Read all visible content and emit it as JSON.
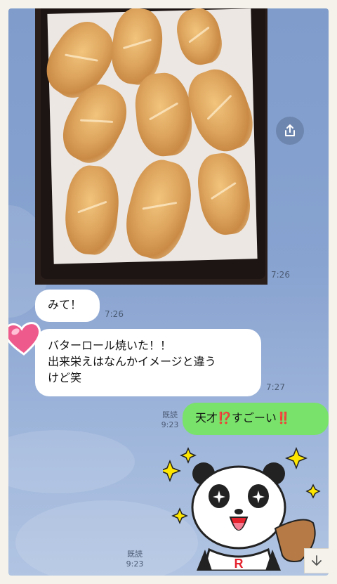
{
  "messages": {
    "photo": {
      "time": "7:26"
    },
    "msg1": {
      "text": "みて！",
      "time": "7:26"
    },
    "msg2": {
      "lines": [
        "バターロール焼いた！！",
        "出来栄えはなんかイメージと違う",
        "けど笑"
      ],
      "time": "7:27"
    },
    "reply": {
      "text": "天才⁉️すごーい‼️",
      "read": "既読",
      "time": "9:23"
    },
    "sticker": {
      "read": "既読",
      "time": "9:23",
      "logo": "R"
    }
  },
  "colors": {
    "chat_background": "#88a3d0",
    "incoming_bubble": "#ffffff",
    "outgoing_bubble": "#79e26a",
    "accent_red": "#e4232e"
  },
  "icons": {
    "share": "share-icon",
    "heart": "heart-icon",
    "scroll_down": "arrow-down-icon"
  }
}
